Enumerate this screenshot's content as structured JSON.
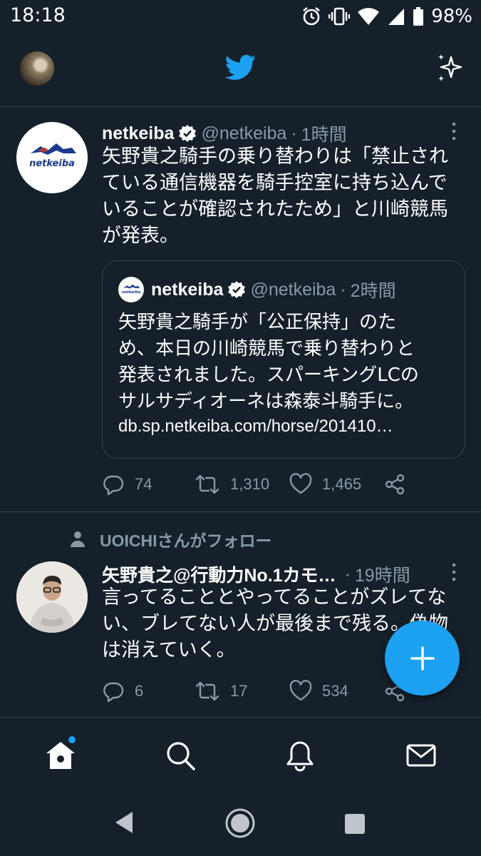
{
  "status_bar": {
    "time": "18:18",
    "battery": "98%"
  },
  "header": {
    "logo": "twitter-bird-icon",
    "accent": "#1da1f2"
  },
  "tweets": [
    {
      "display_name": "netkeiba",
      "handle": "@netkeiba",
      "separator": "·",
      "time": "1時間",
      "text_lines": [
        "矢野貴之騎手の乗り替わりは「禁止され",
        "ている通信機器を騎手控室に持ち込んで",
        "いることが確認されたため」と川崎競馬",
        "が発表。"
      ],
      "quote": {
        "display_name": "netkeiba",
        "handle": "@netkeiba",
        "separator": "·",
        "time": "2時間",
        "text_lines": [
          "矢野貴之騎手が「公正保持」のた",
          "め、本日の川崎競馬で乗り替わりと",
          "発表されました。スパーキングLCの",
          "サルサディオーネは森泰斗騎手に。"
        ],
        "link": "db.sp.netkeiba.com/horse/201410…"
      },
      "replies": "74",
      "retweets": "1,310",
      "likes": "1,465"
    },
    {
      "context": "UOICHIさんがフォロー",
      "display_name": "矢野貴之@行動力No.1カモ…",
      "separator": "·",
      "time": "19時間",
      "text_lines": [
        "言ってることとやってることがズレてな",
        "い、ブレてない人が最後まで残る。偽物",
        "は消えていく。"
      ],
      "replies": "6",
      "retweets": "17",
      "likes": "534"
    }
  ],
  "bottom_nav": [
    "home-icon",
    "search-icon",
    "notifications-icon",
    "messages-icon"
  ]
}
